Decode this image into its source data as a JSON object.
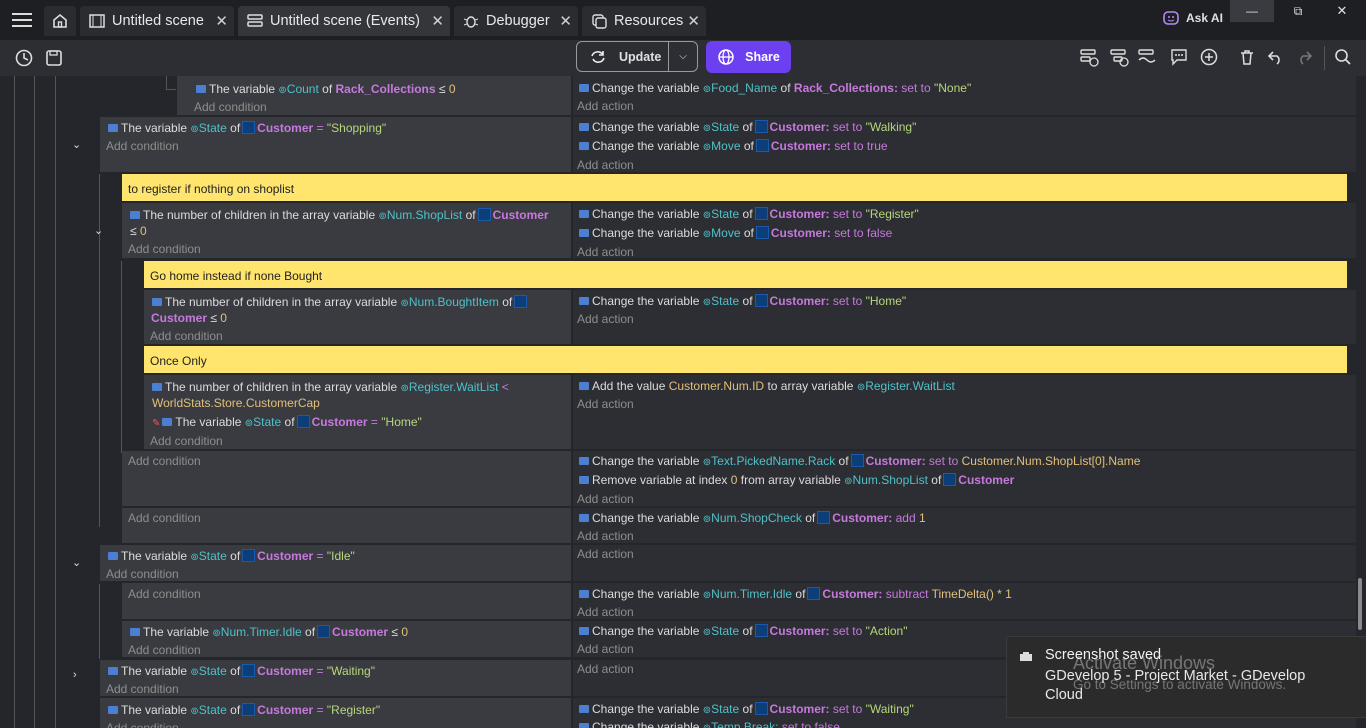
{
  "window": {
    "ask_ai": "Ask AI",
    "minimize": "—",
    "maximize": "⧉",
    "close": "✕"
  },
  "tabs": [
    {
      "label": "Untitled scene",
      "icon": "film-icon"
    },
    {
      "label": "Untitled scene (Events)",
      "icon": "events-icon"
    },
    {
      "label": "Debugger",
      "icon": "bug-icon"
    },
    {
      "label": "Resources",
      "icon": "resources-icon"
    }
  ],
  "toolbar": {
    "update_label": "Update",
    "share_label": "Share"
  },
  "events": {
    "add_condition": "Add condition",
    "add_action": "Add action",
    "comments": [
      "to register if nothing on shoplist",
      "Go home instead if none Bought",
      "Once Only"
    ],
    "e1": {
      "cond1": [
        "The variable",
        "Count",
        "of",
        "Rack_Collections",
        "≤",
        "0"
      ],
      "act1": [
        "Change the variable",
        "Food_Name",
        "of",
        "Rack_Collections:",
        "set to",
        "\"None\""
      ]
    },
    "e2": {
      "cond1": [
        "The variable",
        "State",
        "of",
        "Customer",
        "=",
        "\"Shopping\""
      ],
      "act1": [
        "Change the variable",
        "State",
        "of",
        "Customer:",
        "set to",
        "\"Walking\""
      ],
      "act2": [
        "Change the variable",
        "Move",
        "of",
        "Customer:",
        "set to true"
      ]
    },
    "e3": {
      "cond1": [
        "The number of children in the array variable",
        "Num.ShopList",
        "of",
        "Customer",
        "≤",
        "0"
      ],
      "act1": [
        "Change the variable",
        "State",
        "of",
        "Customer:",
        "set to",
        "\"Register\""
      ],
      "act2": [
        "Change the variable",
        "Move",
        "of",
        "Customer:",
        "set to false"
      ]
    },
    "e4": {
      "cond1": [
        "The number of children in the array variable",
        "Num.BoughtItem",
        "of",
        "Customer",
        "≤",
        "0"
      ],
      "act1": [
        "Change the variable",
        "State",
        "of",
        "Customer:",
        "set to",
        "\"Home\""
      ]
    },
    "e5": {
      "cond1": [
        "The number of children in the array variable",
        "Register.WaitList",
        "<",
        "WorldStats.Store.CustomerCap"
      ],
      "cond2": [
        "The variable",
        "State",
        "of",
        "Customer",
        "=",
        "\"Home\""
      ],
      "act1": [
        "Add the value",
        "Customer.Num.ID",
        "to array variable",
        "Register.WaitList"
      ]
    },
    "e6": {
      "act1": [
        "Change the variable",
        "Text.PickedName.Rack",
        "of",
        "Customer:",
        "set to",
        "Customer.Num.ShopList[0].Name"
      ],
      "act2": [
        "Remove variable at index",
        "0",
        "from array variable",
        "Num.ShopList",
        "of",
        "Customer"
      ]
    },
    "e7": {
      "act1": [
        "Change the variable",
        "Num.ShopCheck",
        "of",
        "Customer:",
        "add",
        "1"
      ]
    },
    "e8": {
      "cond1": [
        "The variable",
        "State",
        "of",
        "Customer",
        "=",
        "\"Idle\""
      ]
    },
    "e9": {
      "act1": [
        "Change the variable",
        "Num.Timer.Idle",
        "of",
        "Customer:",
        "subtract",
        "TimeDelta() * 1"
      ]
    },
    "e10": {
      "cond1": [
        "The variable",
        "Num.Timer.Idle",
        "of",
        "Customer",
        "≤",
        "0"
      ],
      "act1": [
        "Change the variable",
        "State",
        "of",
        "Customer:",
        "set to",
        "\"Action\""
      ]
    },
    "e11": {
      "cond1": [
        "The variable",
        "State",
        "of",
        "Customer",
        "=",
        "\"Waiting\""
      ]
    },
    "e12": {
      "cond1": [
        "The variable",
        "State",
        "of",
        "Customer",
        "=",
        "\"Register\""
      ],
      "act1": [
        "Change the variable",
        "State",
        "of",
        "Customer:",
        "set to",
        "\"Waiting\""
      ],
      "act2_partial": [
        "Change the variable",
        "Temp.Break:",
        "set to false"
      ]
    }
  },
  "toast": {
    "title": "Screenshot saved",
    "body": "GDevelop 5 - Project Market - GDevelop Cloud",
    "watermark_title": "Activate Windows",
    "watermark_body": "Go to Settings to activate Windows."
  },
  "colors": {
    "background": "#25262b",
    "condition_bg": "#3a3b41",
    "action_bg": "#2d2e33",
    "comment_bg": "#ffe46e",
    "share_button": "#6c3ff0",
    "variable": "#4fc1c9",
    "object": "#c679dd",
    "string": "#b7d77b",
    "number": "#e0c07a"
  }
}
